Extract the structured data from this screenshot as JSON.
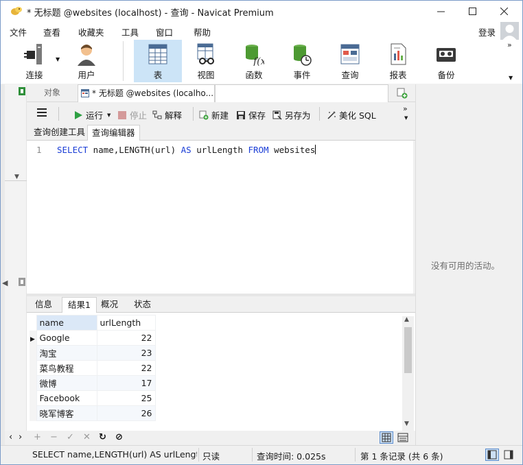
{
  "window": {
    "title": "* 无标题 @websites (localhost) - 查询 - Navicat Premium"
  },
  "menubar": {
    "items": [
      "文件",
      "查看",
      "收藏夹",
      "工具",
      "窗口",
      "帮助"
    ],
    "login": "登录"
  },
  "main_toolbar": {
    "tools": [
      {
        "label": "连接",
        "icon": "plug-connection-icon"
      },
      {
        "label": "用户",
        "icon": "user-icon"
      },
      {
        "label": "表",
        "icon": "table-icon",
        "active": true
      },
      {
        "label": "视图",
        "icon": "view-glasses-icon"
      },
      {
        "label": "函数",
        "icon": "function-icon"
      },
      {
        "label": "事件",
        "icon": "event-clock-icon"
      },
      {
        "label": "查询",
        "icon": "query-icon"
      },
      {
        "label": "报表",
        "icon": "report-icon"
      },
      {
        "label": "备份",
        "icon": "backup-tape-icon"
      }
    ]
  },
  "doc_tabs": {
    "objects": "对象",
    "query": "* 无标题 @websites (localho..."
  },
  "query_toolbar": {
    "run": "运行",
    "stop": "停止",
    "explain": "解释",
    "new": "新建",
    "save": "保存",
    "save_as": "另存为",
    "beautify": "美化 SQL"
  },
  "sub_tabs": {
    "builder": "查询创建工具",
    "editor": "查询编辑器"
  },
  "editor": {
    "line_number": "1",
    "kw_select": "SELECT",
    "t1": " name,LENGTH(url) ",
    "kw_as": "AS",
    "t2": " urlLength ",
    "kw_from": "FROM",
    "t3": " websites"
  },
  "result_tabs": [
    "信息",
    "结果1",
    "概况",
    "状态"
  ],
  "result_grid": {
    "columns": [
      "name",
      "urlLength"
    ],
    "rows": [
      [
        "Google",
        "22"
      ],
      [
        "淘宝",
        "23"
      ],
      [
        "菜鸟教程",
        "22"
      ],
      [
        "微博",
        "17"
      ],
      [
        "Facebook",
        "25"
      ],
      [
        "晓军博客",
        "26"
      ]
    ]
  },
  "activity_panel": {
    "empty_text": "没有可用的活动。"
  },
  "statusbar": {
    "sql": "SELECT name,LENGTH(url) AS urlLength F",
    "readonly": "只读",
    "query_time": "查询时间: 0.025s",
    "record": "第 1 条记录 (共 6 条)"
  },
  "colors": {
    "active_tool_bg": "#cce4f7",
    "keyword": "#1a3dd6",
    "selected_header_bg": "#dbe8f7"
  }
}
